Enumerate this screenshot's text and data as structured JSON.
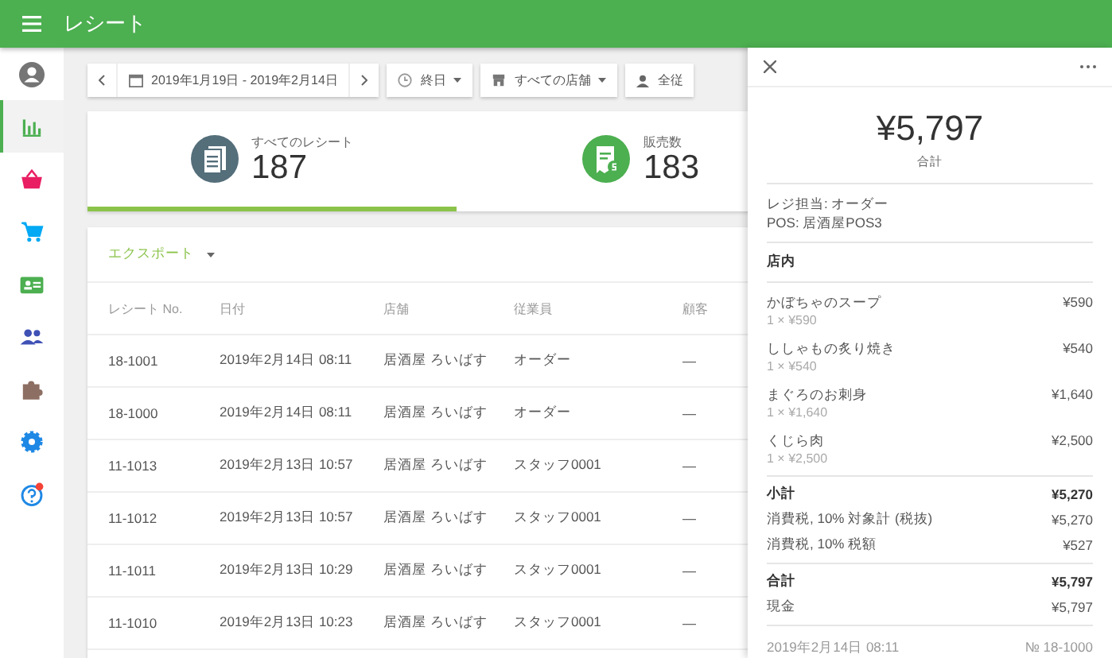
{
  "app_bar": {
    "title": "レシート"
  },
  "sidebar": {
    "items": [
      {
        "kind": "avatar",
        "selected": false
      },
      {
        "kind": "chart",
        "selected": true
      },
      {
        "kind": "basket",
        "selected": false
      },
      {
        "kind": "cart",
        "selected": false
      },
      {
        "kind": "card",
        "selected": false
      },
      {
        "kind": "people",
        "selected": false
      },
      {
        "kind": "puzzle",
        "selected": false
      },
      {
        "kind": "gear",
        "selected": false
      },
      {
        "kind": "help",
        "selected": false
      }
    ]
  },
  "filters": {
    "date_range": "2019年1月19日 - 2019年2月14日",
    "time": "終日",
    "store": "すべての店舗",
    "employee": "全従"
  },
  "stats": [
    {
      "kind": "receipts",
      "label": "すべてのレシート",
      "value": "187",
      "selected": true
    },
    {
      "kind": "sales",
      "label": "販売数",
      "value": "183",
      "selected": false
    }
  ],
  "table": {
    "export": "エクスポート",
    "columns": [
      "レシート No.",
      "日付",
      "店舗",
      "従業員",
      "顧客"
    ],
    "rows": [
      [
        "18-1001",
        "2019年2月14日 08:11",
        "居酒屋 ろいばす",
        "オーダー",
        "—"
      ],
      [
        "18-1000",
        "2019年2月14日 08:11",
        "居酒屋 ろいばす",
        "オーダー",
        "—"
      ],
      [
        "11-1013",
        "2019年2月13日 10:57",
        "居酒屋 ろいばす",
        "スタッフ0001",
        "—"
      ],
      [
        "11-1012",
        "2019年2月13日 10:57",
        "居酒屋 ろいばす",
        "スタッフ0001",
        "—"
      ],
      [
        "11-1011",
        "2019年2月13日 10:29",
        "居酒屋 ろいばす",
        "スタッフ0001",
        "—"
      ],
      [
        "11-1010",
        "2019年2月13日 10:23",
        "居酒屋 ろいばす",
        "スタッフ0001",
        "—"
      ]
    ]
  },
  "receipt": {
    "total": "¥5,797",
    "total_label": "合計",
    "info": [
      "レジ担当: オーダー",
      "POS: 居酒屋POS3"
    ],
    "section": "店内",
    "items": [
      {
        "name": "かぼちゃのスープ",
        "price": "¥590",
        "qty": "1 × ¥590"
      },
      {
        "name": "ししゃもの炙り焼き",
        "price": "¥540",
        "qty": "1 × ¥540"
      },
      {
        "name": "まぐろのお刺身",
        "price": "¥1,640",
        "qty": "1 × ¥1,640"
      },
      {
        "name": "くじら肉",
        "price": "¥2,500",
        "qty": "1 × ¥2,500"
      }
    ],
    "summary": [
      [
        {
          "label": "小計",
          "amount": "¥5,270",
          "bold": true
        },
        {
          "label": "消費税, 10% 対象計 (税抜)",
          "amount": "¥5,270",
          "bold": false
        },
        {
          "label": "消費税, 10% 税額",
          "amount": "¥527",
          "bold": false
        }
      ],
      [
        {
          "label": "合計",
          "amount": "¥5,797",
          "bold": true
        },
        {
          "label": "現金",
          "amount": "¥5,797",
          "bold": false
        }
      ]
    ],
    "date": "2019年2月14日 08:11",
    "number": "№ 18-1000"
  }
}
